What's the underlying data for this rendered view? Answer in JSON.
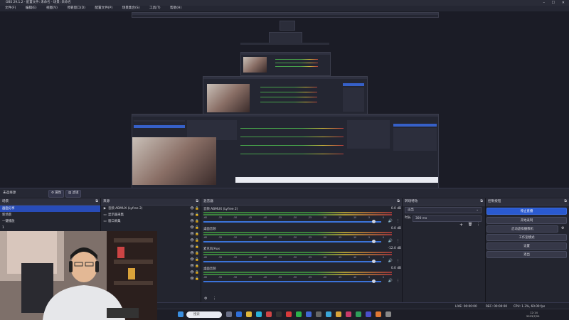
{
  "window": {
    "title": "OBS 29.1.2 - 配置文件: 未命名 - 场景: 未命名",
    "controls": {
      "minimize": "–",
      "maximize": "☐",
      "close": "✕"
    }
  },
  "menu": [
    "文件(F)",
    "编辑(E)",
    "视图(V)",
    "停靠窗口(D)",
    "配置文件(P)",
    "场景集合(S)",
    "工具(T)",
    "帮助(H)"
  ],
  "controls_bar": {
    "label": "未选择源",
    "properties": "属性",
    "filters": "滤镜"
  },
  "scenes": {
    "title": "场景",
    "items": [
      "画面分享",
      "新场景",
      "一键播放",
      "1"
    ]
  },
  "sources": {
    "title": "来源",
    "items": [
      {
        "label": "音频 ABMUX (Lyfree 2)",
        "icon": "▶"
      },
      {
        "label": "显示器采集",
        "icon": "▭"
      },
      {
        "label": "窗口采集",
        "icon": "▭"
      },
      {
        "label": "",
        "icon": ""
      },
      {
        "label": "",
        "icon": ""
      },
      {
        "label": "",
        "icon": ""
      },
      {
        "label": "",
        "icon": ""
      },
      {
        "label": "",
        "icon": ""
      },
      {
        "label": "",
        "icon": ""
      },
      {
        "label": "",
        "icon": ""
      },
      {
        "label": "",
        "icon": ""
      },
      {
        "label": "",
        "icon": ""
      }
    ]
  },
  "mixer": {
    "title": "混音器",
    "ticks": [
      "-60",
      "-55",
      "-50",
      "-45",
      "-40",
      "-35",
      "-30",
      "-25",
      "-20",
      "-15",
      "-10",
      "-5",
      "0"
    ],
    "channels": [
      {
        "name": "音频 ABMUX (Lyfree 2)",
        "db": "0.0 dB",
        "level": 0.96
      },
      {
        "name": "桌面音频",
        "db": "0.0 dB",
        "level": 0.96
      },
      {
        "name": "麦克风/Aux",
        "db": "-12.0 dB",
        "level": 0.96
      },
      {
        "name": "桌面音频",
        "db": "0.0 dB",
        "level": 0.96
      }
    ]
  },
  "transitions": {
    "title": "转场特效",
    "type": "淡出",
    "duration_label": "时长",
    "duration": "300 ms"
  },
  "controls_dock": {
    "title": "控制按钮",
    "buttons": [
      "停止直播",
      "开始录制",
      "启动虚拟摄像机",
      "工作室模式",
      "设置",
      "退出"
    ]
  },
  "status": {
    "live": "LIVE: 00:00:00",
    "rec": "REC: 00:00:00",
    "cpu": "CPU: 1.3%, 60.00 fps"
  },
  "taskbar": {
    "search_placeholder": "搜索",
    "time": "12:14",
    "date": "2023/7/20"
  },
  "colors": {
    "accent": "#2a5ad0",
    "selection": "#284cb8"
  }
}
